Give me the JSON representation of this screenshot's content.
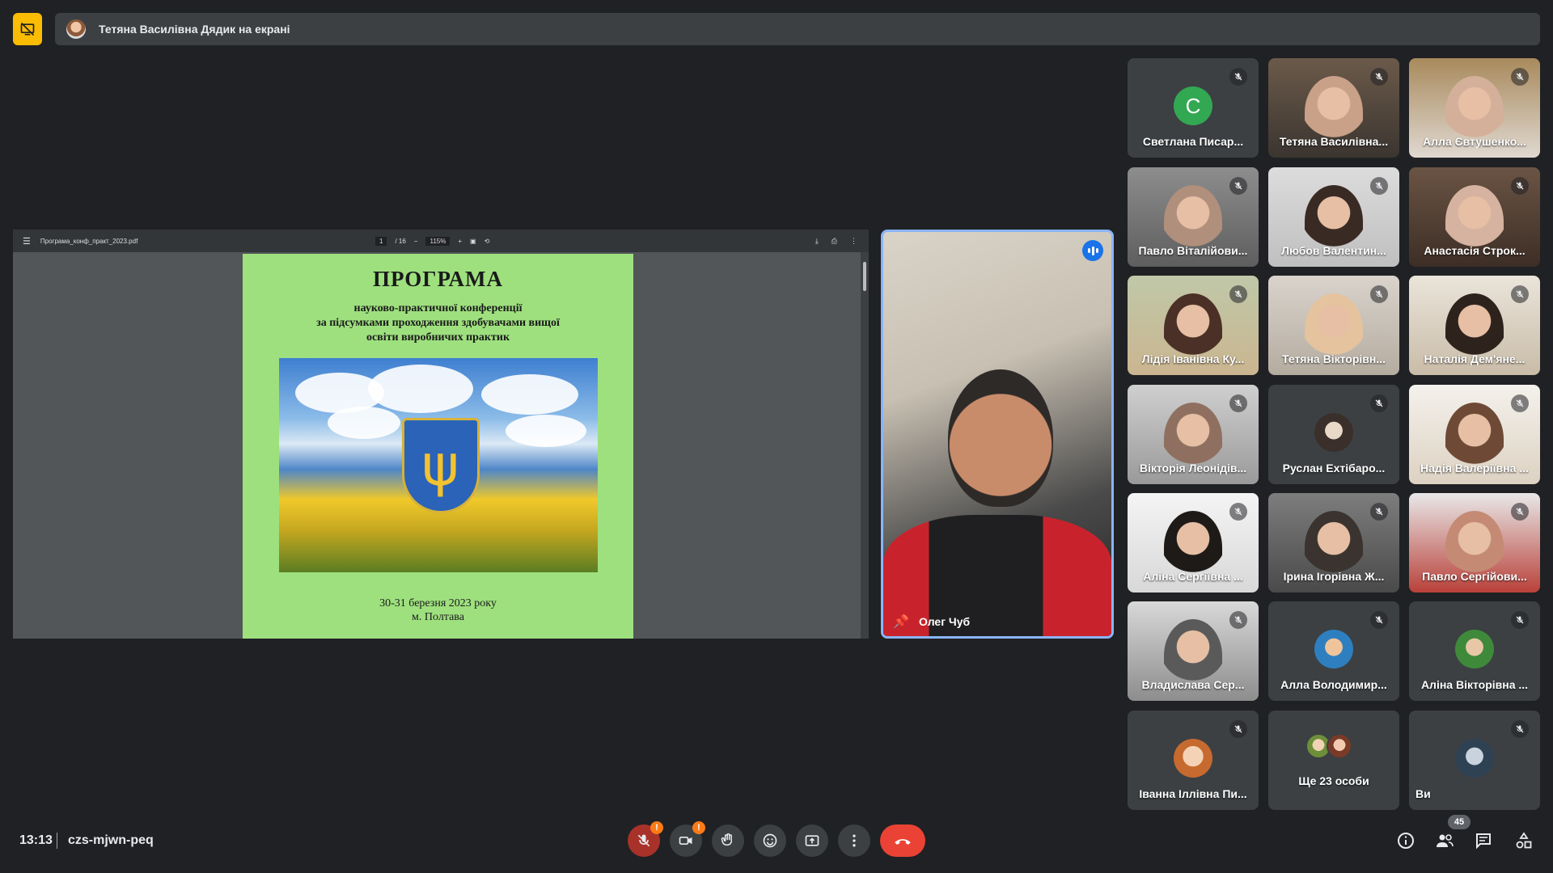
{
  "presenter_bar": {
    "text": "Тетяна Василівна Дядик на екрані"
  },
  "presentation": {
    "file_name": "Програма_конф_практ_2023.pdf",
    "page_current": "1",
    "page_total": "/ 16",
    "zoom": "115%",
    "page": {
      "title": "ПРОГРАМА",
      "subtitle_lines": [
        "науково-практичної конференції",
        "за підсумками проходження здобувачами вищої",
        "освіти виробничих практик"
      ],
      "date": "30-31 березня 2023 року",
      "city": "м. Полтава"
    }
  },
  "speaker": {
    "name": "Олег Чуб"
  },
  "participants": [
    {
      "name": "Светлана Писар...",
      "avatar_letter": "С",
      "muted": true
    },
    {
      "name": "Тетяна Василівна...",
      "muted": true
    },
    {
      "name": "Алла Євтушенко... ",
      "muted": true
    },
    {
      "name": "Павло Віталійови...",
      "muted": true
    },
    {
      "name": "Любов Валентин...",
      "muted": true
    },
    {
      "name": "Анастасія Строк...",
      "muted": true
    },
    {
      "name": "Лідія Іванівна Ку...",
      "muted": true
    },
    {
      "name": "Тетяна Вікторівн...",
      "muted": true
    },
    {
      "name": "Наталія Дем'яне...",
      "muted": true
    },
    {
      "name": "Вікторія Леонідів...",
      "muted": true
    },
    {
      "name": "Руслан Ехтібаро...",
      "muted": true
    },
    {
      "name": "Надія Валеріївна ...",
      "muted": true
    },
    {
      "name": "Аліна Сергіївна ...",
      "muted": true
    },
    {
      "name": "Ірина Ігорівна Ж...",
      "muted": true
    },
    {
      "name": "Павло Сергійови...",
      "muted": true
    },
    {
      "name": "Владислава Сер...",
      "muted": true
    },
    {
      "name": "Алла Володимир...",
      "muted": true
    },
    {
      "name": "Аліна Вікторівна ...",
      "muted": true
    },
    {
      "name": "Іванна Іллівна Пи...",
      "muted": true
    },
    {
      "name": "Ще 23 особи",
      "muted": false
    },
    {
      "name": "Ви",
      "muted": true
    }
  ],
  "bottom_bar": {
    "time": "13:13",
    "meeting_code": "czs-mjwn-peq",
    "people_count": "45",
    "warn_mark": "!"
  },
  "colors": {
    "background": "#202124",
    "tile": "#3c4043",
    "accent_blue": "#8ab4f8",
    "hangup_red": "#ea4335",
    "presenting_yellow": "#fbbc04"
  }
}
